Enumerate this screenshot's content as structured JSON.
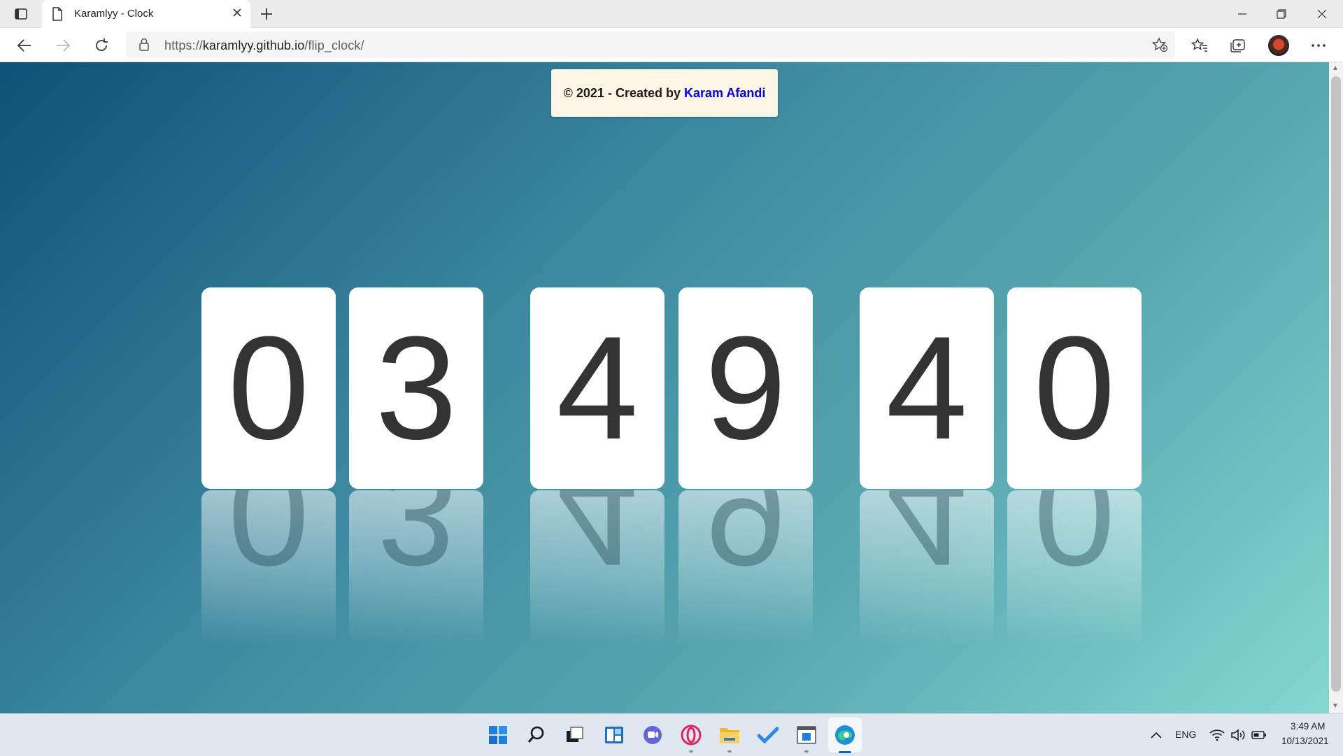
{
  "browser": {
    "tab_title": "Karamlyy - Clock",
    "url_prefix": "https://",
    "url_host": "karamlyy.github.io",
    "url_path": "/flip_clock/"
  },
  "page": {
    "credit_prefix": "© 2021 - Created by",
    "credit_author": "Karam Afandi",
    "clock_digits": [
      "0",
      "3",
      "4",
      "9",
      "4",
      "0"
    ],
    "background_colors": [
      "#0e5178",
      "#3d8aa0",
      "#5aaab2",
      "#84d8d0"
    ]
  },
  "taskbar": {
    "icons": [
      "windows-start-icon",
      "search-icon",
      "task-view-icon",
      "widgets-icon",
      "teams-chat-icon",
      "opera-icon",
      "file-explorer-icon",
      "todo-icon",
      "store-icon",
      "edge-icon"
    ],
    "language": "ENG",
    "time": "3:49 AM",
    "date": "10/13/2021"
  }
}
